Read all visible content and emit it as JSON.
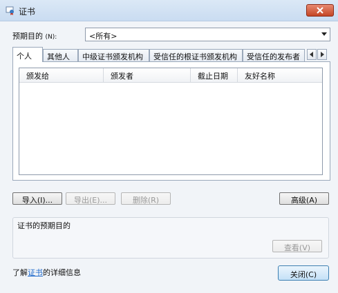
{
  "window": {
    "title": "证书",
    "close_icon": "close-icon"
  },
  "purpose": {
    "label": "预期目的",
    "accel": "(N):",
    "value": "<所有>"
  },
  "tabs": [
    {
      "label": "个人"
    },
    {
      "label": "其他人"
    },
    {
      "label": "中级证书颁发机构"
    },
    {
      "label": "受信任的根证书颁发机构"
    },
    {
      "label": "受信任的发布者"
    }
  ],
  "list": {
    "columns": [
      "颁发给",
      "颁发者",
      "截止日期",
      "友好名称"
    ]
  },
  "buttons": {
    "import": "导入(I)...",
    "export": "导出(E)...",
    "delete": "删除(R)",
    "advanced": "高级(A)",
    "view": "查看(V)",
    "close": "关闭(C)"
  },
  "purpose_group": {
    "legend": "证书的预期目的"
  },
  "footer": {
    "prefix": "了解",
    "link": "证书",
    "suffix": "的详细信息"
  }
}
